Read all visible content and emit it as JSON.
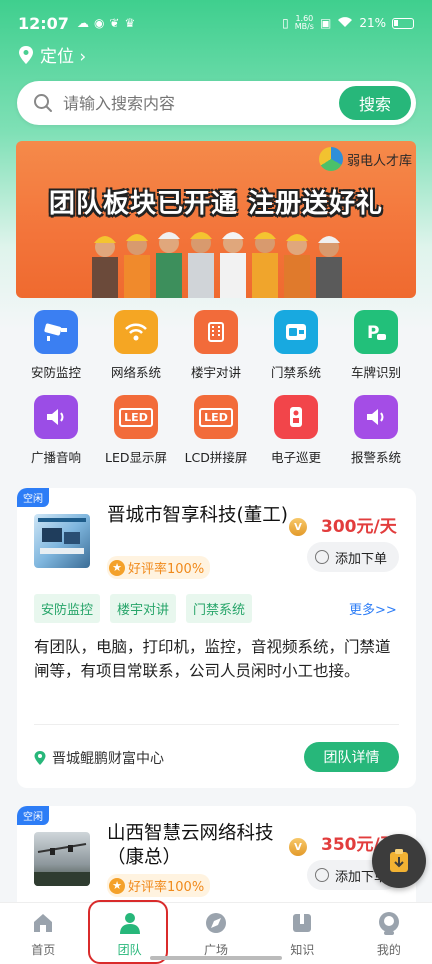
{
  "status_bar": {
    "time": "12:07",
    "network_speed_top": "1.60",
    "network_speed_bottom": "MB/s",
    "battery": "21%"
  },
  "location": {
    "label": "定位 ›"
  },
  "search": {
    "placeholder": "请输入搜索内容",
    "button_label": "搜索"
  },
  "banner": {
    "brand": "弱电人才库",
    "title": "团队板块已开通   注册送好礼"
  },
  "categories": [
    {
      "label": "安防监控",
      "icon": "camera-icon",
      "color": "#3b7ff2"
    },
    {
      "label": "网络系统",
      "icon": "wifi-icon",
      "color": "#f5a623"
    },
    {
      "label": "楼宇对讲",
      "icon": "building-icon",
      "color": "#f26b3a"
    },
    {
      "label": "门禁系统",
      "icon": "card-reader-icon",
      "color": "#18a9e0"
    },
    {
      "label": "车牌识别",
      "icon": "parking-icon",
      "color": "#22c07a"
    },
    {
      "label": "广播音响",
      "icon": "speaker-icon",
      "color": "#9b4de6"
    },
    {
      "label": "LED显示屏",
      "icon": "led-icon",
      "color": "#f26b3a",
      "text": "LED"
    },
    {
      "label": "LCD拼接屏",
      "icon": "led-icon",
      "color": "#f26b3a",
      "text": "LED"
    },
    {
      "label": "电子巡更",
      "icon": "patrol-device-icon",
      "color": "#f2454a"
    },
    {
      "label": "报警系统",
      "icon": "alarm-speaker-icon",
      "color": "#a44de6"
    }
  ],
  "cards": [
    {
      "tag": "空闲",
      "company": "晋城市智享科技(董工)",
      "vip": "V",
      "price": "300元/天",
      "add_label": "添加下单",
      "rating": "好评率100%",
      "tags": [
        "安防监控",
        "楼宇对讲",
        "门禁系统"
      ],
      "more": "更多>>",
      "description": "有团队，电脑，打印机，监控，音视频系统，门禁道闸等，有项目常联系，公司人员闲时小工也接。",
      "address": "晋城鲲鹏财富中心",
      "detail_label": "团队详情"
    },
    {
      "tag": "空闲",
      "company": "山西智慧云网络科技（康总）",
      "vip": "V",
      "price": "350元/天",
      "add_label": "添加下单",
      "rating": "好评率100%"
    }
  ],
  "tabbar": [
    {
      "label": "首页",
      "icon": "home-icon",
      "active": false
    },
    {
      "label": "团队",
      "icon": "team-icon",
      "active": true
    },
    {
      "label": "广场",
      "icon": "compass-icon",
      "active": false
    },
    {
      "label": "知识",
      "icon": "book-icon",
      "active": false
    },
    {
      "label": "我的",
      "icon": "profile-icon",
      "active": false
    }
  ],
  "colors": {
    "primary_green": "#27b77a",
    "price_red": "#e23d3d",
    "link_blue": "#2d7df6",
    "highlight_red": "#d92b2b"
  }
}
